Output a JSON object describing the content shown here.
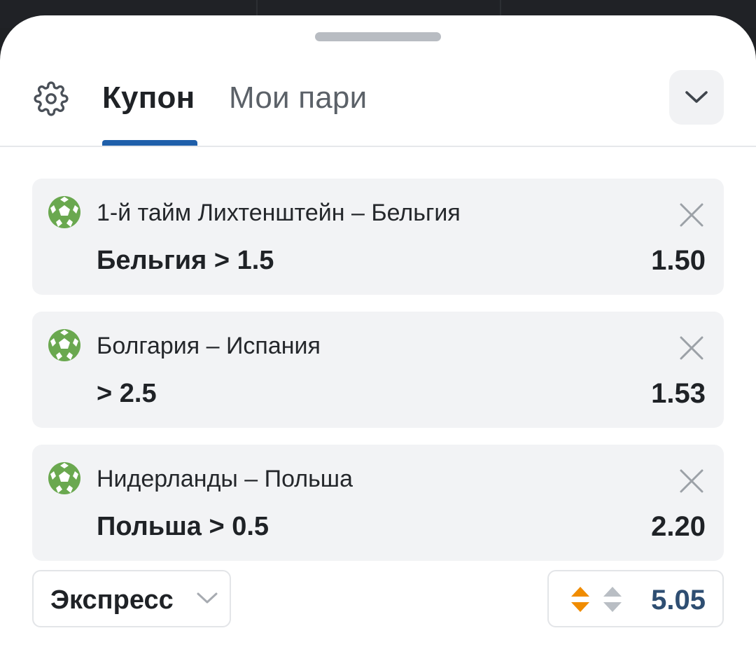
{
  "tabs": [
    {
      "label": "Купон",
      "active": true
    },
    {
      "label": "Мои пари",
      "active": false
    }
  ],
  "colors": {
    "accent": "#1f5faa",
    "ball": "#6aa84f",
    "odds_change_up": "#f08c00",
    "total_odds": "#2e4e72"
  },
  "icons": {
    "settings": "gear-icon",
    "collapse": "chevron-down-icon",
    "sport": "football-icon",
    "remove": "close-icon",
    "odds_change": "arrows-up-down-icon"
  },
  "bets": [
    {
      "event": "1-й тайм Лихтенштейн – Бельгия",
      "outcome": "Бельгия > 1.5",
      "odds": "1.50"
    },
    {
      "event": "Болгария – Испания",
      "outcome": "> 2.5",
      "odds": "1.53"
    },
    {
      "event": "Нидерланды – Польша",
      "outcome": "Польша > 0.5",
      "odds": "2.20"
    }
  ],
  "footer": {
    "bet_type": "Экспресс",
    "total_odds": "5.05"
  }
}
